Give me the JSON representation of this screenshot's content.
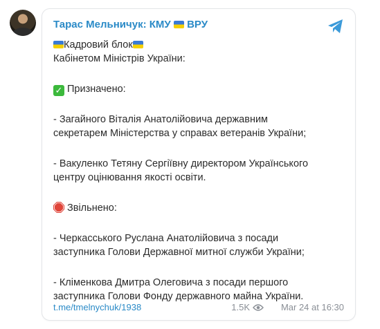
{
  "post": {
    "channel_name": "Тарас Мельничук: КМУ 🇺🇦 ВРУ",
    "channel_name_left": "Тарас Мельничук: КМУ",
    "channel_name_right": "ВРУ",
    "lines": {
      "heading1": "Кадровий блок",
      "heading2": "Кабінетом Міністрів України:",
      "appointed": "Призначено:",
      "a1_1": "- Загайного Віталія Анатолійовича державним",
      "a1_2": "секретарем Міністерства у справах ветеранів України;",
      "a2_1": "- Вакуленко Тетяну Сергіївну директором Українського",
      "a2_2": "центру оцінювання якості освіти.",
      "dismissed": "Звільнено:",
      "d1_1": "- Черкасського Руслана Анатолійовича з посади",
      "d1_2": "заступника Голови Державної митної служби України;",
      "d2_1": "- Кліменкова Дмитра Олеговича з посади першого",
      "d2_2": "заступника Голови Фонду державного майна України."
    },
    "footer": {
      "link": "t.me/tmelnychuk/1938",
      "views": "1.5K",
      "date": "Mar 24 at 16:30"
    }
  },
  "colors": {
    "accent": "#2a8ac7",
    "check": "#3cb93c",
    "stop": "#e0453a"
  },
  "icons": [
    "avatar",
    "ukraine-flag-icon",
    "telegram-icon",
    "check-mark-icon",
    "stop-sign-icon",
    "eye-icon"
  ]
}
